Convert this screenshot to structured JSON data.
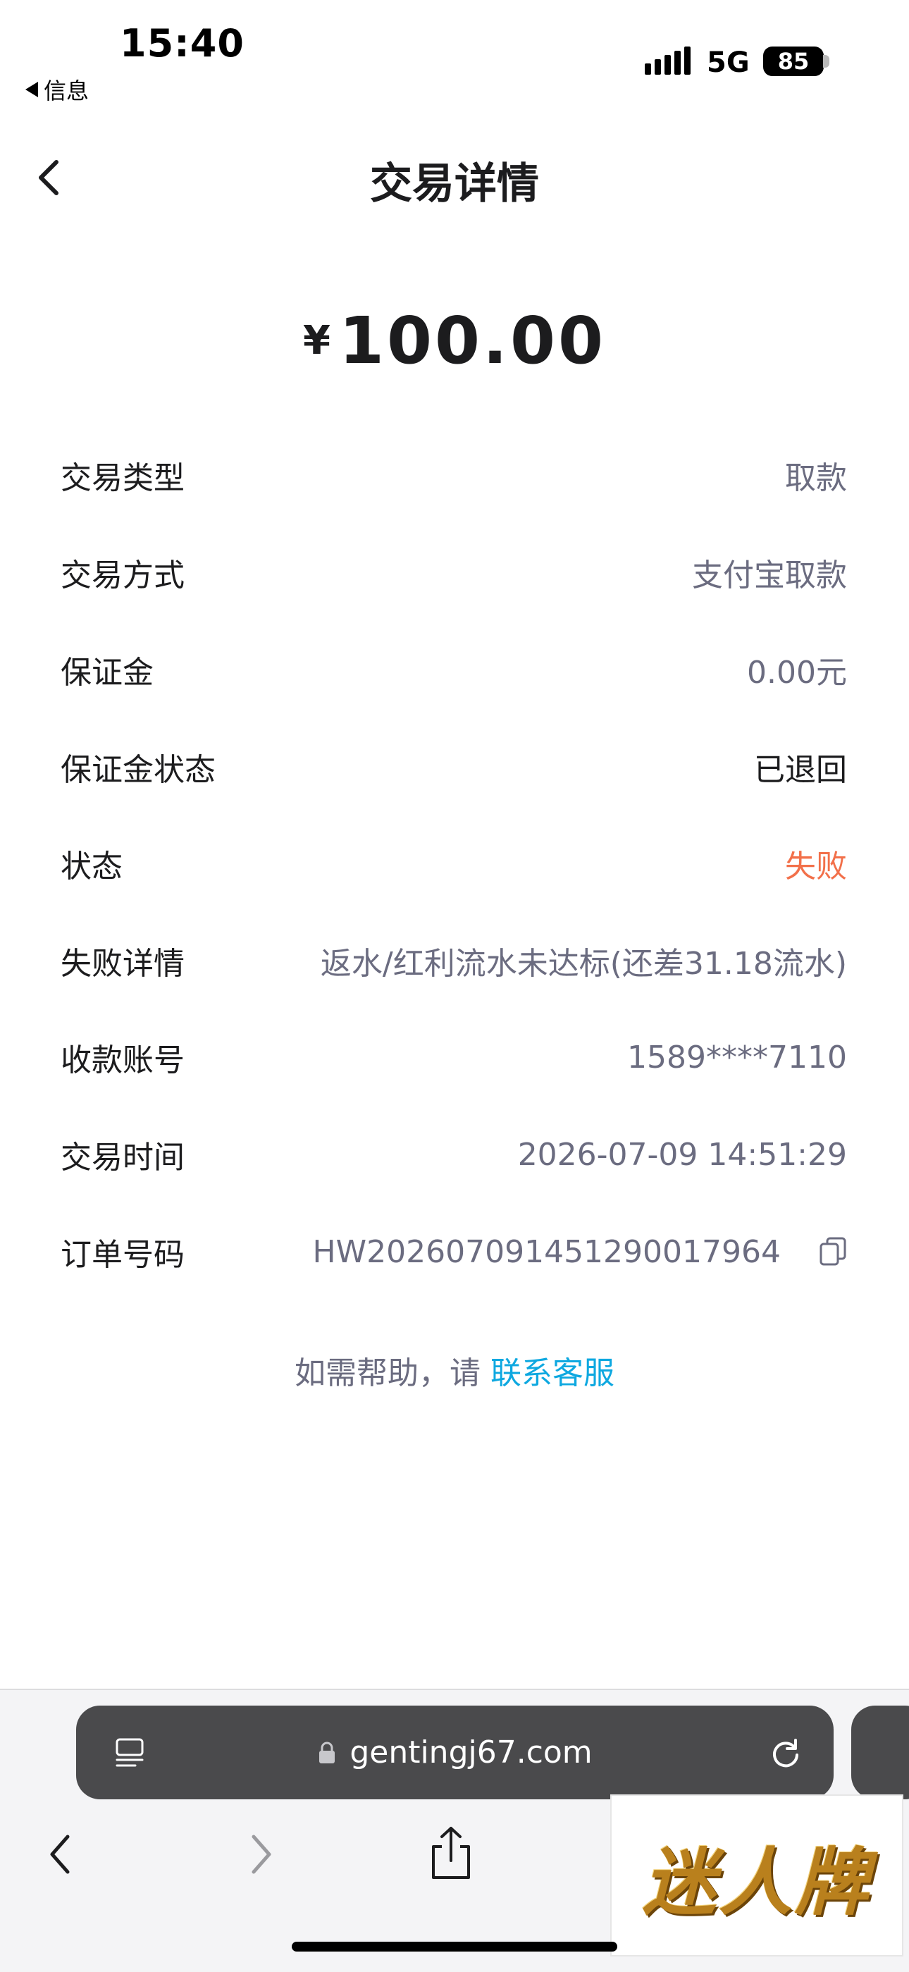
{
  "status_bar": {
    "time": "15:40",
    "back_app_label": "信息",
    "network": "5G",
    "battery": "85"
  },
  "header": {
    "title": "交易详情",
    "back_icon": "chevron-left-icon"
  },
  "amount": {
    "currency": "¥",
    "value": "100.00"
  },
  "details": {
    "rows": [
      {
        "label": "交易类型",
        "value": "取款",
        "color": "#6b6c80"
      },
      {
        "label": "交易方式",
        "value": "支付宝取款",
        "color": "#6b6c80"
      },
      {
        "label": "保证金",
        "value": "0.00元",
        "color": "#6b6c80"
      },
      {
        "label": "保证金状态",
        "value": "已退回",
        "color": "#1c1c1e"
      },
      {
        "label": "状态",
        "value": "失败",
        "color": "#f2704a"
      },
      {
        "label": "失败详情",
        "value": "返水/红利流水未达标(还差31.18流水)",
        "color": "#6b6c80"
      },
      {
        "label": "收款账号",
        "value": "1589****7110",
        "color": "#6b6c80"
      },
      {
        "label": "交易时间",
        "value": "2026-07-09 14:51:29",
        "color": "#6b6c80"
      },
      {
        "label": "订单号码",
        "value": "HW202607091451290017964",
        "color": "#6b6c80"
      }
    ]
  },
  "help": {
    "prefix": "如需帮助，请",
    "link": "联系客服",
    "link_color": "#0ea8e0"
  },
  "browser": {
    "url": "gentingj67.com"
  },
  "watermark": {
    "text": "迷人牌"
  }
}
